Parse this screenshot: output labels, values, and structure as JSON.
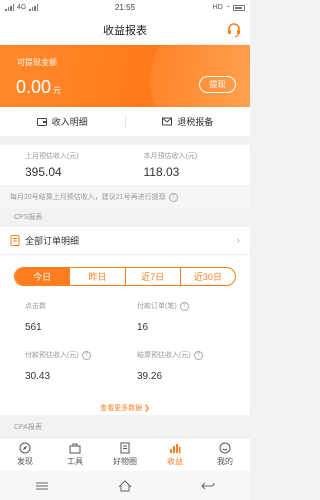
{
  "status_bar": {
    "left": "4G",
    "time": "21:55",
    "right": "HD"
  },
  "header": {
    "title": "收益报表"
  },
  "balance": {
    "label": "可提现金额",
    "amount": "0.00",
    "unit": "元",
    "withdraw_label": "提现"
  },
  "links": {
    "income_detail": "收入明细",
    "tax_report": "退税报备"
  },
  "income": {
    "last_month_label": "上月预估收入(元)",
    "last_month_value": "395.04",
    "this_month_label": "本月预估收入(元)",
    "this_month_value": "118.03"
  },
  "notice": "每月20号结算上月预估收入，建议21号再进行提现",
  "cps": {
    "section_title": "CPS报表",
    "all_orders_label": "全部订单明细",
    "periods": [
      "今日",
      "昨日",
      "近7日",
      "近30日"
    ],
    "active_period": "今日",
    "stats": {
      "clicks_label": "点击数",
      "clicks_value": "561",
      "paid_orders_label": "付款订单(笔)",
      "paid_orders_value": "16",
      "paid_income_label": "付款预估收入(元)",
      "paid_income_value": "30.43",
      "settled_income_label": "结算预估收入(元)",
      "settled_income_value": "39.26"
    },
    "more_label": "查看更多数据 ❯"
  },
  "cpa": {
    "section_title": "CPA报表"
  },
  "bottom_nav": [
    {
      "label": "发现",
      "icon": "compass-icon"
    },
    {
      "label": "工具",
      "icon": "toolbox-icon"
    },
    {
      "label": "好物圈",
      "icon": "document-icon"
    },
    {
      "label": "收益",
      "icon": "bar-chart-icon"
    },
    {
      "label": "我的",
      "icon": "smiley-icon"
    }
  ],
  "active_nav": "收益",
  "colors": {
    "accent": "#ff7d1e",
    "hero_gradient_start": "#ff8a2c",
    "background": "#f2f2f2"
  }
}
